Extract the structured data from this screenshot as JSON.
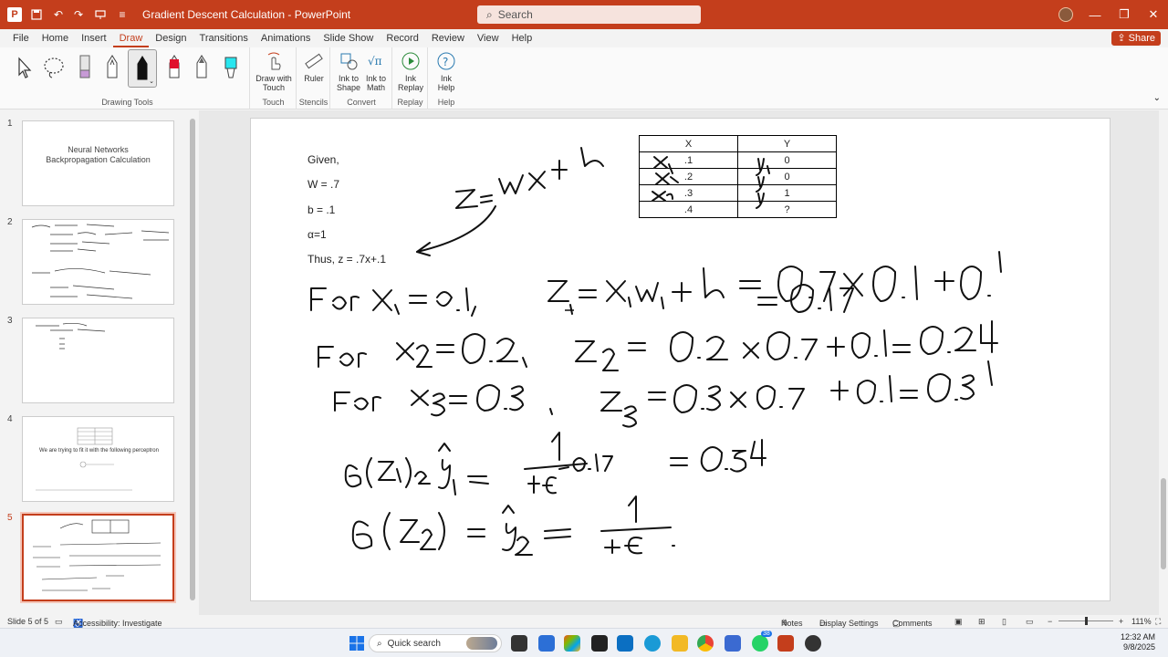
{
  "titlebar": {
    "title": "Gradient Descent Calculation  -  PowerPoint",
    "app_logo": "P",
    "search_placeholder": "Search"
  },
  "tabs": [
    "File",
    "Home",
    "Insert",
    "Draw",
    "Design",
    "Transitions",
    "Animations",
    "Slide Show",
    "Record",
    "Review",
    "View",
    "Help"
  ],
  "share_label": "Share",
  "ribbon": {
    "groups": {
      "drawing_tools": "Drawing Tools",
      "touch": "Touch",
      "stencils": "Stencils",
      "convert": "Convert",
      "replay": "Replay",
      "help": "Help"
    },
    "buttons": {
      "draw_with_touch_1": "Draw with",
      "draw_with_touch_2": "Touch",
      "ruler": "Ruler",
      "ink_to_shape_1": "Ink to",
      "ink_to_shape_2": "Shape",
      "ink_to_math_1": "Ink to",
      "ink_to_math_2": "Math",
      "ink_replay_1": "Ink",
      "ink_replay_2": "Replay",
      "ink_help_1": "Ink",
      "ink_help_2": "Help"
    }
  },
  "thumbnails": [
    {
      "num": "1",
      "line1": "Neural Networks",
      "line2": "Backpropagation Calculation"
    },
    {
      "num": "2"
    },
    {
      "num": "3"
    },
    {
      "num": "4",
      "caption": "We are trying to fit it with the following perceptron"
    },
    {
      "num": "5"
    }
  ],
  "slide": {
    "given": "Given,",
    "w": "W = .7",
    "b": "b = .1",
    "alpha": "α=1",
    "thus": "Thus, z = .7x+.1",
    "table": {
      "headers": [
        "X",
        "Y"
      ],
      "rows": [
        [
          ".1",
          "0"
        ],
        [
          ".2",
          "0"
        ],
        [
          ".3",
          "1"
        ],
        [
          ".4",
          "?"
        ]
      ]
    }
  },
  "status": {
    "slide_count": "Slide 5 of 5",
    "accessibility": "Accessibility: Investigate",
    "notes": "Notes",
    "display_settings": "Display Settings",
    "comments": "Comments",
    "zoom": "111%"
  },
  "taskbar": {
    "search": "Quick search",
    "time": "12:32 AM",
    "date": "9/8/2025",
    "badge": "38"
  },
  "colors": {
    "accent": "#c43e1c"
  }
}
